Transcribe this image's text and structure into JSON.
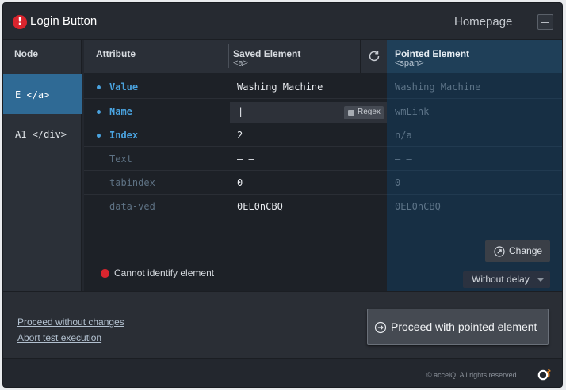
{
  "window": {
    "title": "Login Button",
    "nav_label": "Homepage",
    "alert_icon": "!"
  },
  "header": {
    "node": "Node",
    "attribute": "Attribute",
    "saved": "Saved Element",
    "saved_tag": "<a>",
    "pointed": "Pointed Element",
    "pointed_tag": "<span>"
  },
  "nodes": [
    {
      "label": "E </a>",
      "active": true
    },
    {
      "label": "A1 </div>",
      "active": false
    }
  ],
  "attributes": [
    {
      "name": "Value",
      "saved": "Washing Machine",
      "pointed": "Washing Machine"
    },
    {
      "name": "Name",
      "saved": "|",
      "pointed": "wmLink",
      "regex_label": "Regex"
    },
    {
      "name": "Index",
      "saved": "2",
      "pointed": "n/a"
    },
    {
      "name": "Text",
      "saved": "– –",
      "pointed": "– –"
    },
    {
      "name": "tabindex",
      "saved": "0",
      "pointed": "0"
    },
    {
      "name": "data-ved",
      "saved": "0EL0nCBQ",
      "pointed": "0EL0nCBQ"
    }
  ],
  "status": {
    "text": "Cannot identify element",
    "color": "#d9252e"
  },
  "actions": {
    "change": "Change",
    "delay": "Without delay",
    "proceed_without": "Proceed without changes",
    "abort": "Abort test execution",
    "proceed_pointed": "Proceed with pointed element"
  },
  "footer": {
    "copyright": "© accelQ. All rights reserved"
  },
  "colors": {
    "accent": "#4aa3df",
    "active_node": "#2f6a95",
    "pointed_bg": "#172f44",
    "alert": "#d9252e"
  }
}
